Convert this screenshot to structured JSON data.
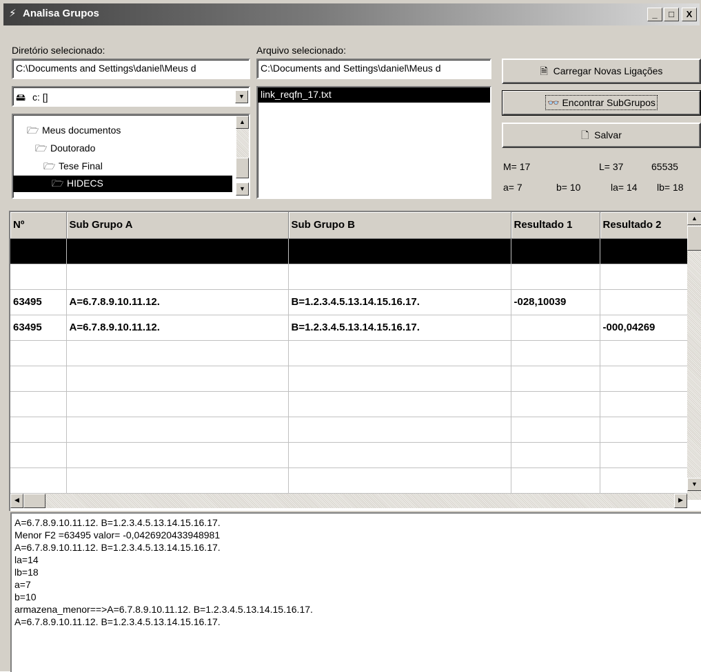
{
  "window": {
    "title": "Analisa Grupos",
    "minimize": "_",
    "maximize": "□",
    "close": "X"
  },
  "directory": {
    "label": "Diretório selecionado:",
    "value": "C:\\Documents and Settings\\daniel\\Meus d"
  },
  "file": {
    "label": "Arquivo selecionado:",
    "value": "C:\\Documents and Settings\\daniel\\Meus d",
    "list": [
      "link_reqfn_17.txt"
    ]
  },
  "drive": {
    "value": "c: []"
  },
  "folders": [
    {
      "name": "Meus documentos",
      "selected": false
    },
    {
      "name": "Doutorado",
      "selected": false
    },
    {
      "name": "Tese Final",
      "selected": false
    },
    {
      "name": "HIDECS",
      "selected": true
    }
  ],
  "buttons": {
    "load": "Carregar Novas Ligações",
    "find": "Encontrar SubGrupos",
    "save": "Salvar"
  },
  "stats": {
    "m": "M= 17",
    "l": "L= 37",
    "max": "65535",
    "a": "a= 7",
    "b": "b= 10",
    "la": "la= 14",
    "lb": "lb= 18"
  },
  "grid": {
    "headers": [
      "Nº",
      "Sub Grupo A",
      "Sub Grupo B",
      "Resultado 1",
      "Resultado 2"
    ],
    "rows": [
      [
        "",
        "",
        "",
        "",
        ""
      ],
      [
        "",
        "",
        "",
        "",
        ""
      ],
      [
        "63495",
        "A=6.7.8.9.10.11.12.",
        "B=1.2.3.4.5.13.14.15.16.17.",
        "-028,10039",
        ""
      ],
      [
        "63495",
        "A=6.7.8.9.10.11.12.",
        "B=1.2.3.4.5.13.14.15.16.17.",
        "",
        "-000,04269"
      ],
      [
        "",
        "",
        "",
        "",
        ""
      ],
      [
        "",
        "",
        "",
        "",
        ""
      ],
      [
        "",
        "",
        "",
        "",
        ""
      ],
      [
        "",
        "",
        "",
        "",
        ""
      ],
      [
        "",
        "",
        "",
        "",
        ""
      ],
      [
        "",
        "",
        "",
        "",
        ""
      ]
    ]
  },
  "log": [
    "A=6.7.8.9.10.11.12. B=1.2.3.4.5.13.14.15.16.17.",
    "Menor F2 =63495 valor= -0,0426920433948981",
    "A=6.7.8.9.10.11.12. B=1.2.3.4.5.13.14.15.16.17.",
    "la=14",
    "lb=18",
    "a=7",
    "b=10",
    "armazena_menor==>A=6.7.8.9.10.11.12. B=1.2.3.4.5.13.14.15.16.17.",
    "A=6.7.8.9.10.11.12. B=1.2.3.4.5.13.14.15.16.17."
  ]
}
